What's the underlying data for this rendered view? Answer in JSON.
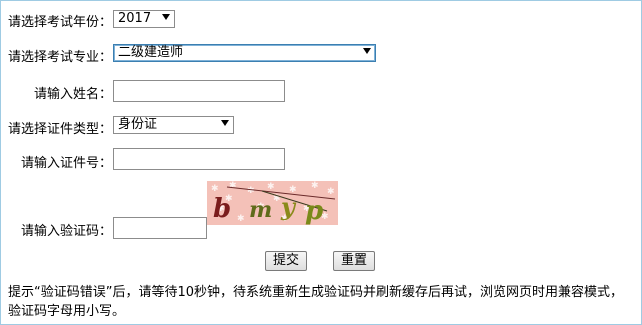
{
  "form": {
    "year_label": "请选择考试年份：",
    "year_value": "2017",
    "major_label": "请选择考试专业：",
    "major_value": "二级建造师",
    "name_label": "请输入姓名：",
    "idtype_label": "请选择证件类型：",
    "idtype_value": "身份证",
    "idnum_label": "请输入证件号：",
    "captcha_label": "请输入验证码：",
    "captcha_text": "bmyp"
  },
  "buttons": {
    "submit": "提交",
    "reset": "重置"
  },
  "hint": "提示“验证码错误”后，请等待10秒钟，待系统重新生成验证码并刷新缓存后再试，浏览网页时用兼容模式，验证码字母用小写。"
}
